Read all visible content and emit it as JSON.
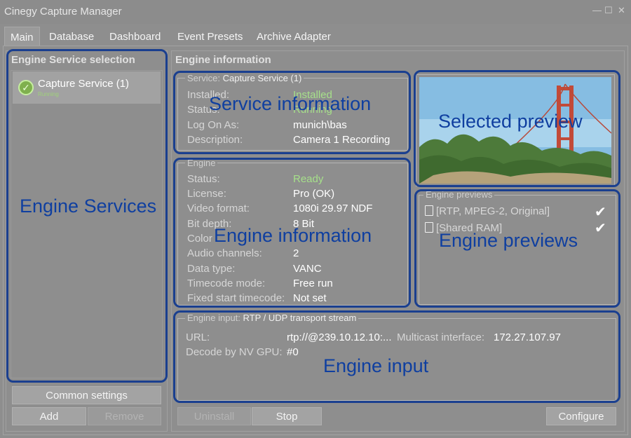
{
  "window": {
    "title": "Cinegy Capture Manager",
    "minimize": "—",
    "maximize": "☐",
    "close": "✕"
  },
  "tabs": [
    {
      "label": "Main",
      "active": true
    },
    {
      "label": "Database"
    },
    {
      "label": "Dashboard"
    },
    {
      "label": "Event Presets"
    },
    {
      "label": "Archive Adapter"
    }
  ],
  "left_panel": {
    "title": "Engine Service selection",
    "services": [
      {
        "name": "Capture Service (1)",
        "status": "Running"
      }
    ],
    "common_settings_label": "Common settings",
    "add_label": "Add",
    "remove_label": "Remove"
  },
  "right_panel": {
    "title": "Engine information",
    "service": {
      "legend": "Service:",
      "legend_value": "Capture Service (1)",
      "rows": [
        {
          "label": "Installed:",
          "value": "Installed"
        },
        {
          "label": "Status:",
          "value": "Running"
        },
        {
          "label": "Log On As:",
          "value": "munich\\bas"
        },
        {
          "label": "Description:",
          "value": "Camera 1 Recording"
        }
      ]
    },
    "engine": {
      "legend": "Engine",
      "rows": [
        {
          "label": "Status:",
          "value": "Ready"
        },
        {
          "label": "License:",
          "value": "Pro (OK)"
        },
        {
          "label": "Video format:",
          "value": "1080i 29.97 NDF"
        },
        {
          "label": "Bit depth:",
          "value": "8 Bit"
        },
        {
          "label": "Color",
          "value": ""
        },
        {
          "label": "Audio channels:",
          "value": "2"
        },
        {
          "label": "Data type:",
          "value": "VANC"
        },
        {
          "label": "Timecode mode:",
          "value": "Free run"
        },
        {
          "label": "Fixed start timecode:",
          "value": "Not set"
        }
      ]
    },
    "previews": {
      "legend": "Engine previews",
      "items": [
        {
          "label": "[RTP, MPEG-2, Original]",
          "checked": true
        },
        {
          "label": "[Shared RAM]",
          "checked": true
        }
      ]
    },
    "input": {
      "legend": "Engine input:",
      "legend_value": "RTP / UDP transport stream",
      "url_label": "URL:",
      "url_value": "rtp://@239.10.12.10:...",
      "multicast_label": "Multicast interface:",
      "multicast_value": "172.27.107.97",
      "gpu_label": "Decode by NV GPU:",
      "gpu_value": "#0"
    },
    "buttons": {
      "uninstall": "Uninstall",
      "stop": "Stop",
      "configure": "Configure"
    }
  },
  "annotations": {
    "engine_services": "Engine Services",
    "service_information": "Service information",
    "selected_preview": "Selected preview",
    "engine_information": "Engine information",
    "engine_previews": "Engine previews",
    "engine_input": "Engine input"
  },
  "colors": {
    "annotation": "#1a3f8f",
    "status_green": "#a6e08a"
  }
}
